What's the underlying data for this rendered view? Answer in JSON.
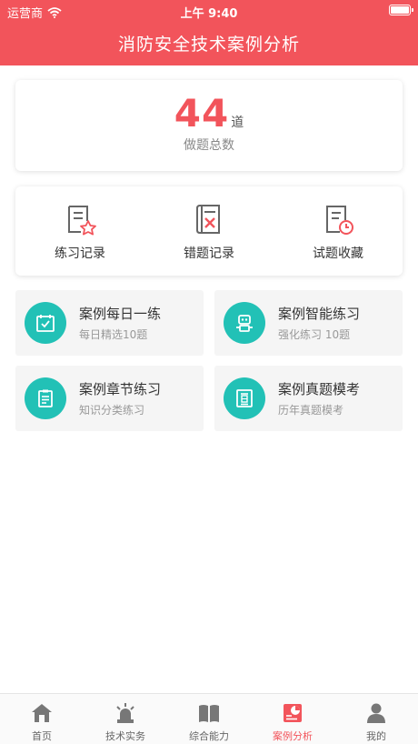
{
  "status_bar": {
    "carrier": "运营商",
    "time": "上午 9:40"
  },
  "header": {
    "title": "消防安全技术案例分析"
  },
  "summary": {
    "count": "44",
    "unit": "道",
    "label": "做题总数",
    "accent": "#f2545b"
  },
  "records": [
    {
      "label": "练习记录",
      "icon": "practice-record-icon"
    },
    {
      "label": "错题记录",
      "icon": "wrong-question-icon"
    },
    {
      "label": "试题收藏",
      "icon": "favorite-question-icon"
    }
  ],
  "practice": [
    {
      "title": "案例每日一练",
      "sub": "每日精选10题",
      "icon": "calendar-check-icon"
    },
    {
      "title": "案例智能练习",
      "sub": "强化练习 10题",
      "icon": "robot-icon"
    },
    {
      "title": "案例章节练习",
      "sub": "知识分类练习",
      "icon": "clipboard-icon"
    },
    {
      "title": "案例真题模考",
      "sub": "历年真题模考",
      "icon": "exam-paper-icon"
    }
  ],
  "tabs": [
    {
      "label": "首页",
      "icon": "home-icon",
      "active": false
    },
    {
      "label": "技术实务",
      "icon": "alarm-light-icon",
      "active": false
    },
    {
      "label": "综合能力",
      "icon": "book-icon",
      "active": false
    },
    {
      "label": "案例分析",
      "icon": "case-analysis-icon",
      "active": true
    },
    {
      "label": "我的",
      "icon": "user-icon",
      "active": false
    }
  ],
  "colors": {
    "brand": "#f2545b",
    "teal": "#22c1b6",
    "icon_gray": "#666666"
  }
}
